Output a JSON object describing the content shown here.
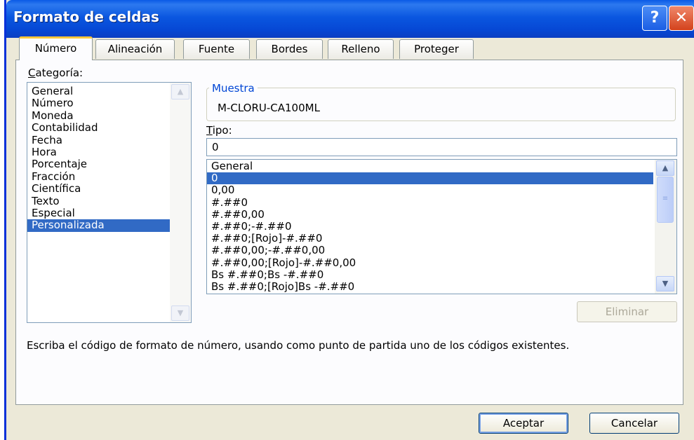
{
  "window": {
    "title": "Formato de celdas",
    "help_label": "?",
    "close_label": "✕"
  },
  "tabs": [
    "Número",
    "Alineación",
    "Fuente",
    "Bordes",
    "Relleno",
    "Proteger"
  ],
  "category": {
    "label": "Categoría:",
    "items": [
      "General",
      "Número",
      "Moneda",
      "Contabilidad",
      "Fecha",
      "Hora",
      "Porcentaje",
      "Fracción",
      "Científica",
      "Texto",
      "Especial",
      "Personalizada"
    ],
    "selected": "Personalizada"
  },
  "sample": {
    "legend": "Muestra",
    "value": "M-CLORU-CA100ML"
  },
  "type": {
    "label": "Tipo:",
    "value": "0",
    "items": [
      "General",
      "0",
      "0,00",
      "#.##0",
      "#.##0,00",
      "#.##0;-#.##0",
      "#.##0;[Rojo]-#.##0",
      "#.##0,00;-#.##0,00",
      "#.##0,00;[Rojo]-#.##0,00",
      "Bs #.##0;Bs -#.##0",
      "Bs #.##0;[Rojo]Bs -#.##0"
    ],
    "selected": "0"
  },
  "delete_button": "Eliminar",
  "help_text": "Escriba el código de formato de número, usando como punto de partida uno de los códigos existentes.",
  "buttons": {
    "ok": "Aceptar",
    "cancel": "Cancelar"
  },
  "icons": {
    "help": "question-icon",
    "close": "close-icon",
    "scroll_up": "arrow-up-icon",
    "scroll_down": "arrow-down-icon",
    "thumb_grip": "grip-icon"
  },
  "colors": {
    "titlebar": "#0a57e0",
    "selection": "#316ac5",
    "active_tab_accent": "#ffc83c",
    "group_legend": "#0046d5"
  }
}
